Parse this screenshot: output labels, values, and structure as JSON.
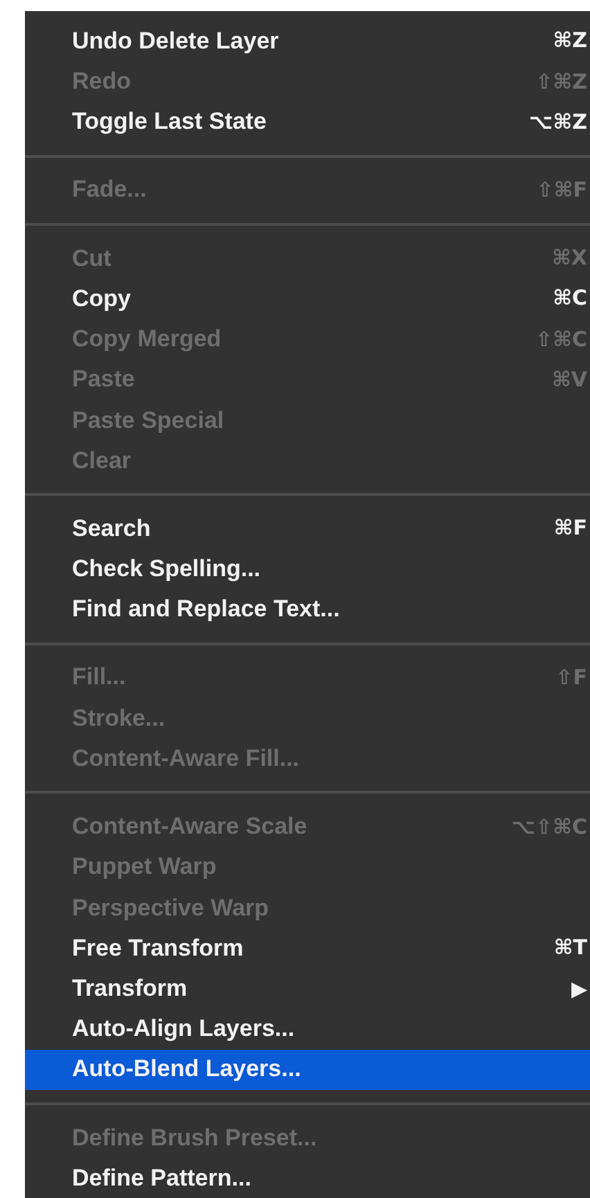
{
  "menu": {
    "groups": [
      {
        "items": [
          {
            "label": "Undo Delete Layer",
            "shortcut": "⌘Z",
            "disabled": false,
            "selected": false
          },
          {
            "label": "Redo",
            "shortcut": "⇧⌘Z",
            "disabled": true,
            "selected": false
          },
          {
            "label": "Toggle Last State",
            "shortcut": "⌥⌘Z",
            "disabled": false,
            "selected": false
          }
        ]
      },
      {
        "items": [
          {
            "label": "Fade...",
            "shortcut": "⇧⌘F",
            "disabled": true,
            "selected": false
          }
        ]
      },
      {
        "items": [
          {
            "label": "Cut",
            "shortcut": "⌘X",
            "disabled": true,
            "selected": false
          },
          {
            "label": "Copy",
            "shortcut": "⌘C",
            "disabled": false,
            "selected": false
          },
          {
            "label": "Copy Merged",
            "shortcut": "⇧⌘C",
            "disabled": true,
            "selected": false
          },
          {
            "label": "Paste",
            "shortcut": "⌘V",
            "disabled": true,
            "selected": false
          },
          {
            "label": "Paste Special",
            "disabled": true,
            "selected": false
          },
          {
            "label": "Clear",
            "disabled": true,
            "selected": false
          }
        ]
      },
      {
        "items": [
          {
            "label": "Search",
            "shortcut": "⌘F",
            "disabled": false,
            "selected": false
          },
          {
            "label": "Check Spelling...",
            "disabled": false,
            "selected": false
          },
          {
            "label": "Find and Replace Text...",
            "disabled": false,
            "selected": false
          }
        ]
      },
      {
        "items": [
          {
            "label": "Fill...",
            "shortcut": "⇧F",
            "disabled": true,
            "selected": false
          },
          {
            "label": "Stroke...",
            "disabled": true,
            "selected": false
          },
          {
            "label": "Content-Aware Fill...",
            "disabled": true,
            "selected": false
          }
        ]
      },
      {
        "items": [
          {
            "label": "Content-Aware Scale",
            "shortcut": "⌥⇧⌘C",
            "disabled": true,
            "selected": false
          },
          {
            "label": "Puppet Warp",
            "disabled": true,
            "selected": false
          },
          {
            "label": "Perspective Warp",
            "disabled": true,
            "selected": false
          },
          {
            "label": "Free Transform",
            "shortcut": "⌘T",
            "disabled": false,
            "selected": false
          },
          {
            "label": "Transform",
            "shortcut": "▶",
            "disabled": false,
            "selected": false
          },
          {
            "label": "Auto-Align Layers...",
            "disabled": false,
            "selected": false
          },
          {
            "label": "Auto-Blend Layers...",
            "disabled": false,
            "selected": true
          }
        ]
      },
      {
        "items": [
          {
            "label": "Define Brush Preset...",
            "disabled": true,
            "selected": false
          },
          {
            "label": "Define Pattern...",
            "disabled": false,
            "selected": false
          }
        ]
      }
    ]
  }
}
